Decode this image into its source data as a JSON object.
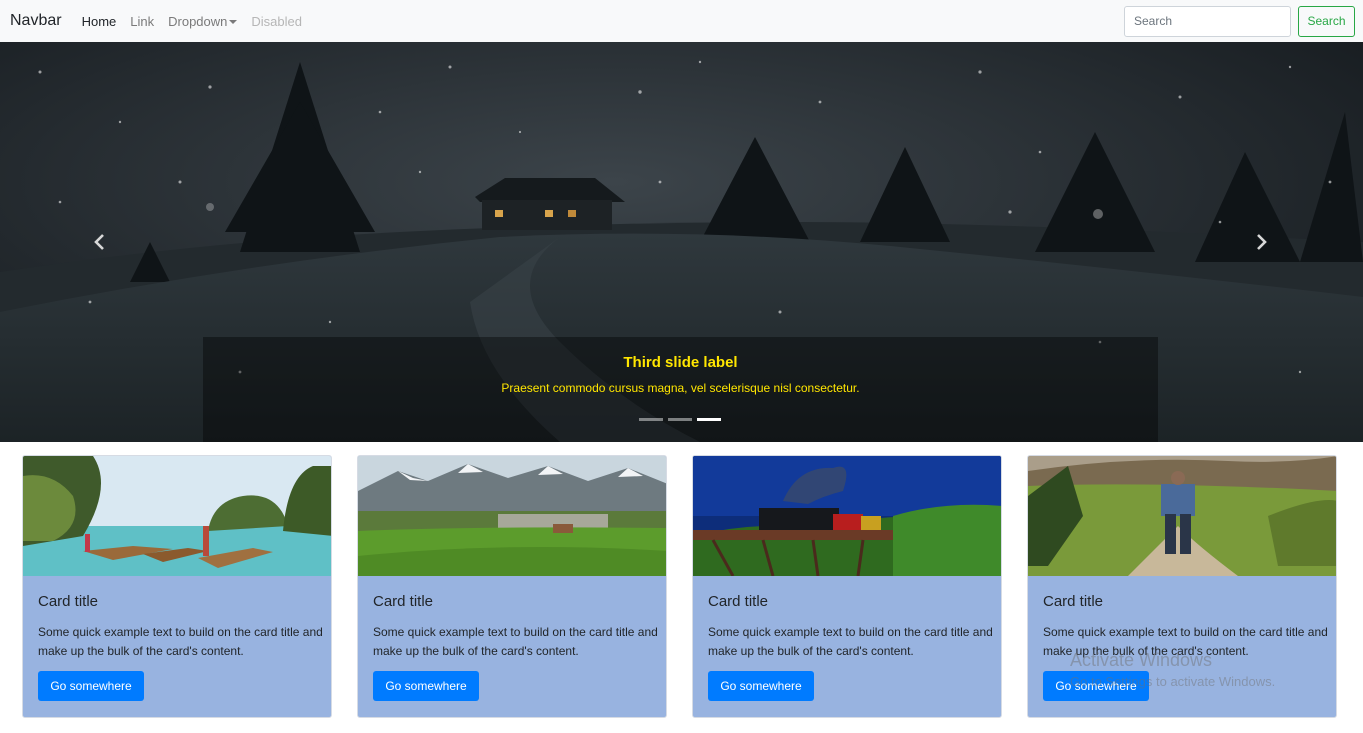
{
  "navbar": {
    "brand": "Navbar",
    "links": [
      "Home",
      "Link",
      "Dropdown",
      "Disabled"
    ],
    "search": {
      "placeholder": "Search",
      "button_label": "Search"
    }
  },
  "carousel": {
    "caption_title": "Third slide label",
    "caption_text": "Praesent commodo cursus magna, vel scelerisque nisl consectetur.",
    "indicator_count": 3,
    "active_indicator": 3
  },
  "cards": [
    {
      "title": "Card title",
      "text": "Some quick example text to build on the card title and make up the bulk of the card's content.",
      "button": "Go somewhere"
    },
    {
      "title": "Card title",
      "text": "Some quick example text to build on the card title and make up the bulk of the card's content.",
      "button": "Go somewhere"
    },
    {
      "title": "Card title",
      "text": "Some quick example text to build on the card title and make up the bulk of the card's content.",
      "button": "Go somewhere"
    },
    {
      "title": "Card title",
      "text": "Some quick example text to build on the card title and make up the bulk of the card's content.",
      "button": "Go somewhere"
    }
  ],
  "watermark": {
    "line1": "Activate Windows",
    "line2": "Go to Settings to activate Windows."
  },
  "colors": {
    "navbar_bg": "#f8f9fa",
    "success": "#28a745",
    "primary": "#007bff",
    "card_bg": "#98b3e0",
    "caption": "#ffe600"
  }
}
